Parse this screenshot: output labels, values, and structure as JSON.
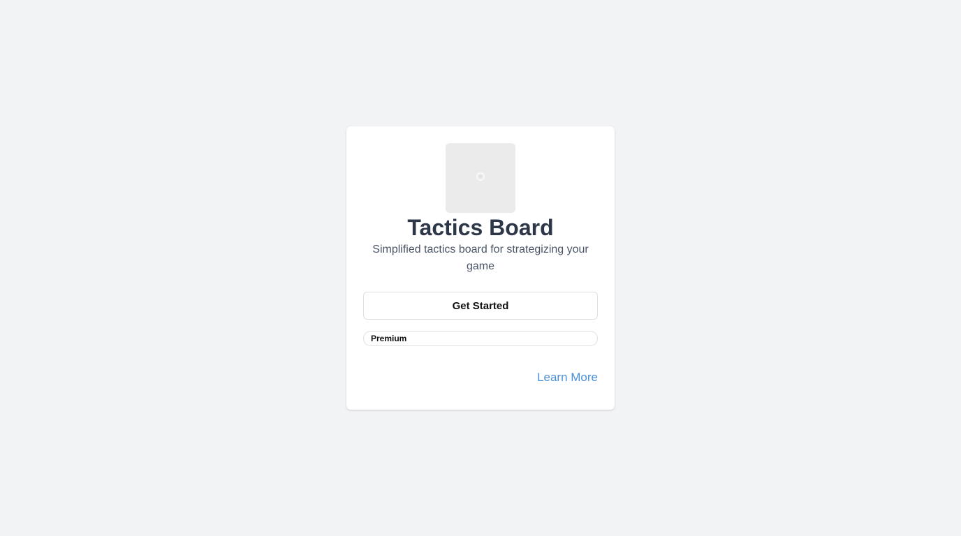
{
  "card": {
    "title": "Tactics Board",
    "description": "Simplified tactics board for strategizing your game",
    "image_icon": "image-placeholder-icon",
    "primary_button": "Get Started",
    "badge": "Premium",
    "link": "Learn More"
  },
  "colors": {
    "background": "#f2f3f5",
    "card": "#ffffff",
    "title": "#2d3748",
    "subtitle": "#4a5568",
    "link": "#4a90d9",
    "placeholder": "#ebebeb"
  }
}
